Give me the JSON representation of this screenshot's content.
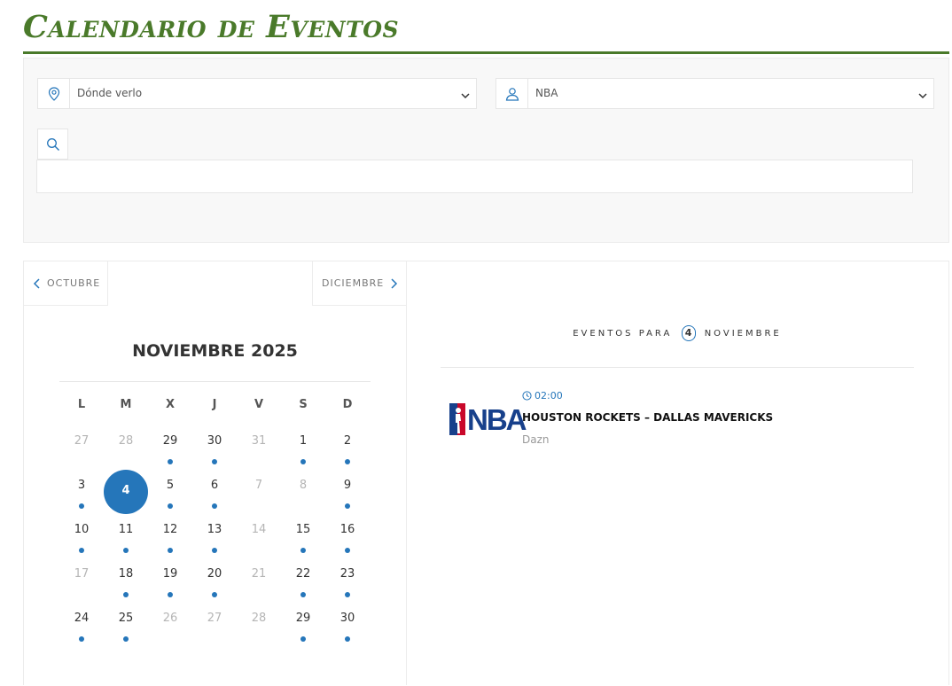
{
  "header": {
    "title": "Calendario de Eventos"
  },
  "filters": {
    "where": {
      "value": "Dónde verlo"
    },
    "competition": {
      "value": "NBA"
    },
    "search": {
      "placeholder": ""
    }
  },
  "calendar": {
    "prev_label": "OCTUBRE",
    "next_label": "DICIEMBRE",
    "month_title": "NOVIEMBRE 2025",
    "weekdays": [
      "L",
      "M",
      "X",
      "J",
      "V",
      "S",
      "D"
    ],
    "selected_day": "4",
    "days": [
      {
        "label": "27",
        "muted": true,
        "dot": false
      },
      {
        "label": "28",
        "muted": true,
        "dot": false
      },
      {
        "label": "29",
        "muted": false,
        "dot": true
      },
      {
        "label": "30",
        "muted": false,
        "dot": true
      },
      {
        "label": "31",
        "muted": true,
        "dot": false
      },
      {
        "label": "1",
        "muted": false,
        "dot": true
      },
      {
        "label": "2",
        "muted": false,
        "dot": true
      },
      {
        "label": "3",
        "muted": false,
        "dot": true
      },
      {
        "label": "4",
        "muted": false,
        "dot": false,
        "selected": true
      },
      {
        "label": "5",
        "muted": false,
        "dot": true
      },
      {
        "label": "6",
        "muted": false,
        "dot": true
      },
      {
        "label": "7",
        "muted": true,
        "dot": false
      },
      {
        "label": "8",
        "muted": true,
        "dot": false
      },
      {
        "label": "9",
        "muted": false,
        "dot": true
      },
      {
        "label": "10",
        "muted": false,
        "dot": true
      },
      {
        "label": "11",
        "muted": false,
        "dot": true
      },
      {
        "label": "12",
        "muted": false,
        "dot": true
      },
      {
        "label": "13",
        "muted": false,
        "dot": true
      },
      {
        "label": "14",
        "muted": true,
        "dot": false
      },
      {
        "label": "15",
        "muted": false,
        "dot": true
      },
      {
        "label": "16",
        "muted": false,
        "dot": true
      },
      {
        "label": "17",
        "muted": true,
        "dot": false
      },
      {
        "label": "18",
        "muted": false,
        "dot": true
      },
      {
        "label": "19",
        "muted": false,
        "dot": true
      },
      {
        "label": "20",
        "muted": false,
        "dot": true
      },
      {
        "label": "21",
        "muted": true,
        "dot": false
      },
      {
        "label": "22",
        "muted": false,
        "dot": true
      },
      {
        "label": "23",
        "muted": false,
        "dot": true
      },
      {
        "label": "24",
        "muted": false,
        "dot": true
      },
      {
        "label": "25",
        "muted": false,
        "dot": true
      },
      {
        "label": "26",
        "muted": true,
        "dot": false
      },
      {
        "label": "27",
        "muted": true,
        "dot": false
      },
      {
        "label": "28",
        "muted": true,
        "dot": false
      },
      {
        "label": "29",
        "muted": false,
        "dot": true
      },
      {
        "label": "30",
        "muted": false,
        "dot": true
      }
    ]
  },
  "events": {
    "heading_prefix": "EVENTOS PARA",
    "heading_day": "4",
    "heading_month": "NOVIEMBRE",
    "items": [
      {
        "time": "02:00",
        "title": "HOUSTON ROCKETS – DALLAS MAVERICKS",
        "channel": "Dazn",
        "logo_text": "NBA",
        "logo_icon": "nba-logo-icon"
      }
    ]
  },
  "icons": {
    "location": "map-pin-icon",
    "user": "user-icon",
    "search": "search-icon",
    "clock": "clock-icon",
    "dropdown": "chevron-down-icon",
    "prev": "chevron-left-icon",
    "next": "chevron-right-icon"
  },
  "colors": {
    "brand_green": "#4a7a2a",
    "accent_blue": "#2576ba",
    "nba_blue": "#17408b",
    "nba_red": "#c9082a"
  }
}
